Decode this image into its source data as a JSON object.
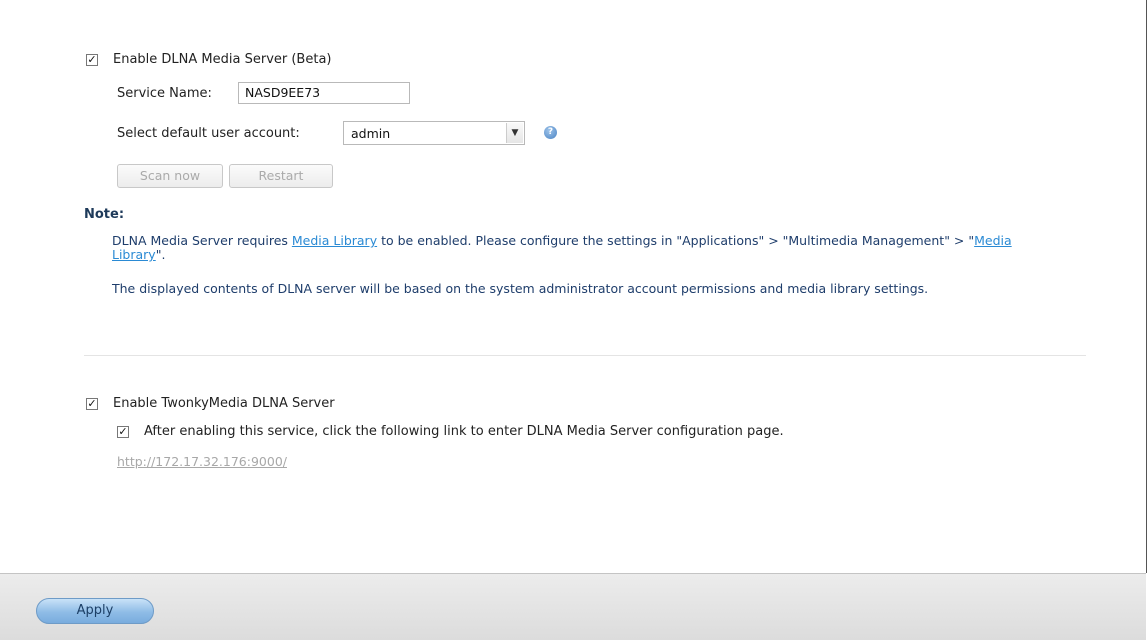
{
  "dlna": {
    "enable_label": "Enable DLNA Media Server (Beta)",
    "enabled": true,
    "service_name_label": "Service Name:",
    "service_name_value": "NASD9EE73",
    "account_label": "Select default user account:",
    "account_value": "admin",
    "scan_label": "Scan now",
    "restart_label": "Restart"
  },
  "note": {
    "title": "Note:",
    "line1_pre": "DLNA Media Server requires ",
    "line1_link1": "Media Library",
    "line1_mid": " to be enabled. Please configure the settings in \"Applications\" > \"Multimedia Management\" > \"",
    "line1_link2": "Media Library",
    "line1_post": "\".",
    "line2": "The displayed contents of DLNA server will be based on the system administrator account permissions and media library settings."
  },
  "twonky": {
    "enable_label": "Enable TwonkyMedia DLNA Server",
    "enabled": true,
    "sub_label": "After enabling this service, click the following link to enter DLNA Media Server configuration page.",
    "sub_checked": true,
    "url": "http://172.17.32.176:9000/"
  },
  "footer": {
    "apply_label": "Apply"
  },
  "icons": {
    "check": "✓",
    "dropdown": "chevron-down-icon",
    "help": "help-icon"
  }
}
